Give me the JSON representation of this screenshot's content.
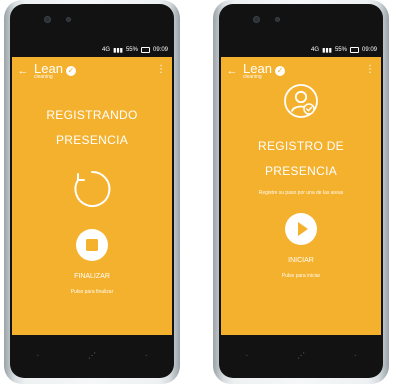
{
  "colors": {
    "accent": "#f4b12d",
    "bezel": "#121212",
    "text": "#ffffff"
  },
  "screens": [
    {
      "status": {
        "network": "4G",
        "signal_percent": "55%",
        "time": "09:09"
      },
      "header": {
        "brand": "Lean",
        "sub": "cleaning",
        "check_icon": "check-circle-icon"
      },
      "title_line1": "REGISTRANDO",
      "title_line2": "PRESENCIA",
      "primary_button": {
        "label": "FINALIZAR"
      },
      "hint": "Pulse para finalizar"
    },
    {
      "status": {
        "network": "4G",
        "signal_percent": "55%",
        "time": "09:09"
      },
      "header": {
        "brand": "Lean",
        "sub": "cleaning",
        "check_icon": "check-circle-icon"
      },
      "title_line1": "REGISTRO DE",
      "title_line2": "PRESENCIA",
      "subtitle": "Registre su paso por una de las areas",
      "primary_button": {
        "label": "INICIAR"
      },
      "hint": "Pulse para iniciar"
    }
  ]
}
